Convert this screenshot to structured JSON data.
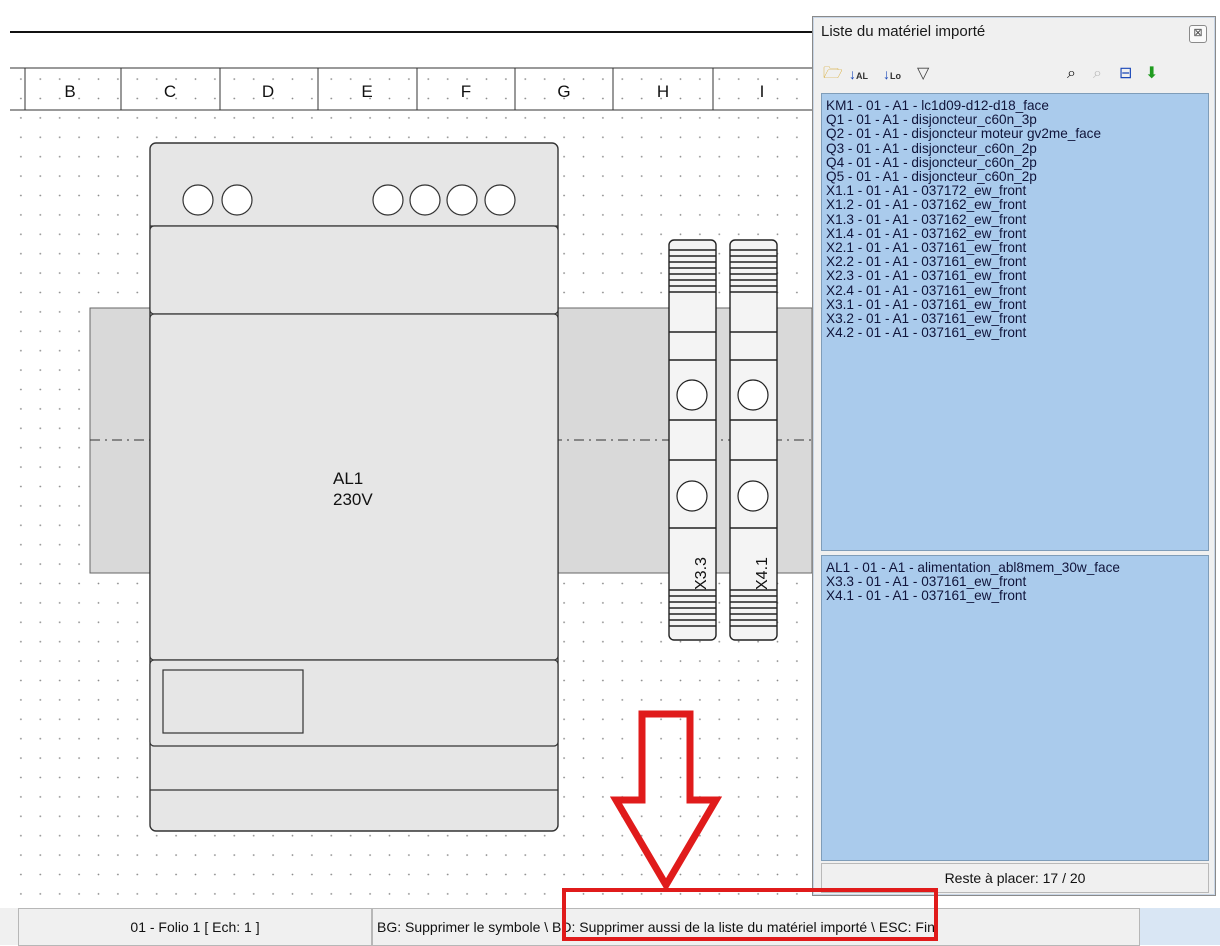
{
  "drawing": {
    "columns": [
      "B",
      "C",
      "D",
      "E",
      "F",
      "G",
      "H",
      "I"
    ],
    "module_label_name": "AL1",
    "module_label_voltage": "230V",
    "terminal_labels": [
      "X3.3",
      "X4.1"
    ],
    "grid_on": true
  },
  "palette": {
    "title": "Liste du matériel importé",
    "close_label": "⊠",
    "toolbar_icons": [
      "folder-open-icon",
      "sort-alpha-icon",
      "sort-location-icon",
      "filter-icon",
      "find-icon",
      "find-next-icon",
      "panel-icon",
      "place-icon"
    ],
    "unplaced_items": [
      "KM1 - 01 - A1 - lc1d09-d12-d18_face",
      "Q1 - 01 - A1 - disjoncteur_c60n_3p",
      "Q2 - 01 - A1 - disjoncteur moteur gv2me_face",
      "Q3 - 01 - A1 - disjoncteur_c60n_2p",
      "Q4 - 01 - A1 - disjoncteur_c60n_2p",
      "Q5 - 01 - A1 - disjoncteur_c60n_2p",
      "X1.1 - 01 - A1 - 037172_ew_front",
      "X1.2 - 01 - A1 - 037162_ew_front",
      "X1.3 - 01 - A1 - 037162_ew_front",
      "X1.4 - 01 - A1 - 037162_ew_front",
      "X2.1 - 01 - A1 - 037161_ew_front",
      "X2.2 - 01 - A1 - 037161_ew_front",
      "X2.3 - 01 - A1 - 037161_ew_front",
      "X2.4 - 01 - A1 - 037161_ew_front",
      "X3.1 - 01 - A1 - 037161_ew_front",
      "X3.2 - 01 - A1 - 037161_ew_front",
      "X4.2 - 01 - A1 - 037161_ew_front"
    ],
    "placed_items": [
      "AL1 - 01 - A1 - alimentation_abl8mem_30w_face",
      "X3.3 - 01 - A1 - 037161_ew_front",
      "X4.1 - 01 - A1 - 037161_ew_front"
    ],
    "remaining_label": "Reste à placer: 17 / 20"
  },
  "statusbar": {
    "folio": "01 - Folio 1 [ Ech: 1 ]",
    "hint": "BG: Supprimer le symbole \\ BD: Supprimer aussi de la liste du matériel importé \\ ESC: Fin"
  },
  "colors": {
    "list_background": "#aacbec",
    "annotation_red": "#e01b1b",
    "grid_dot": "#8a8a8a"
  }
}
